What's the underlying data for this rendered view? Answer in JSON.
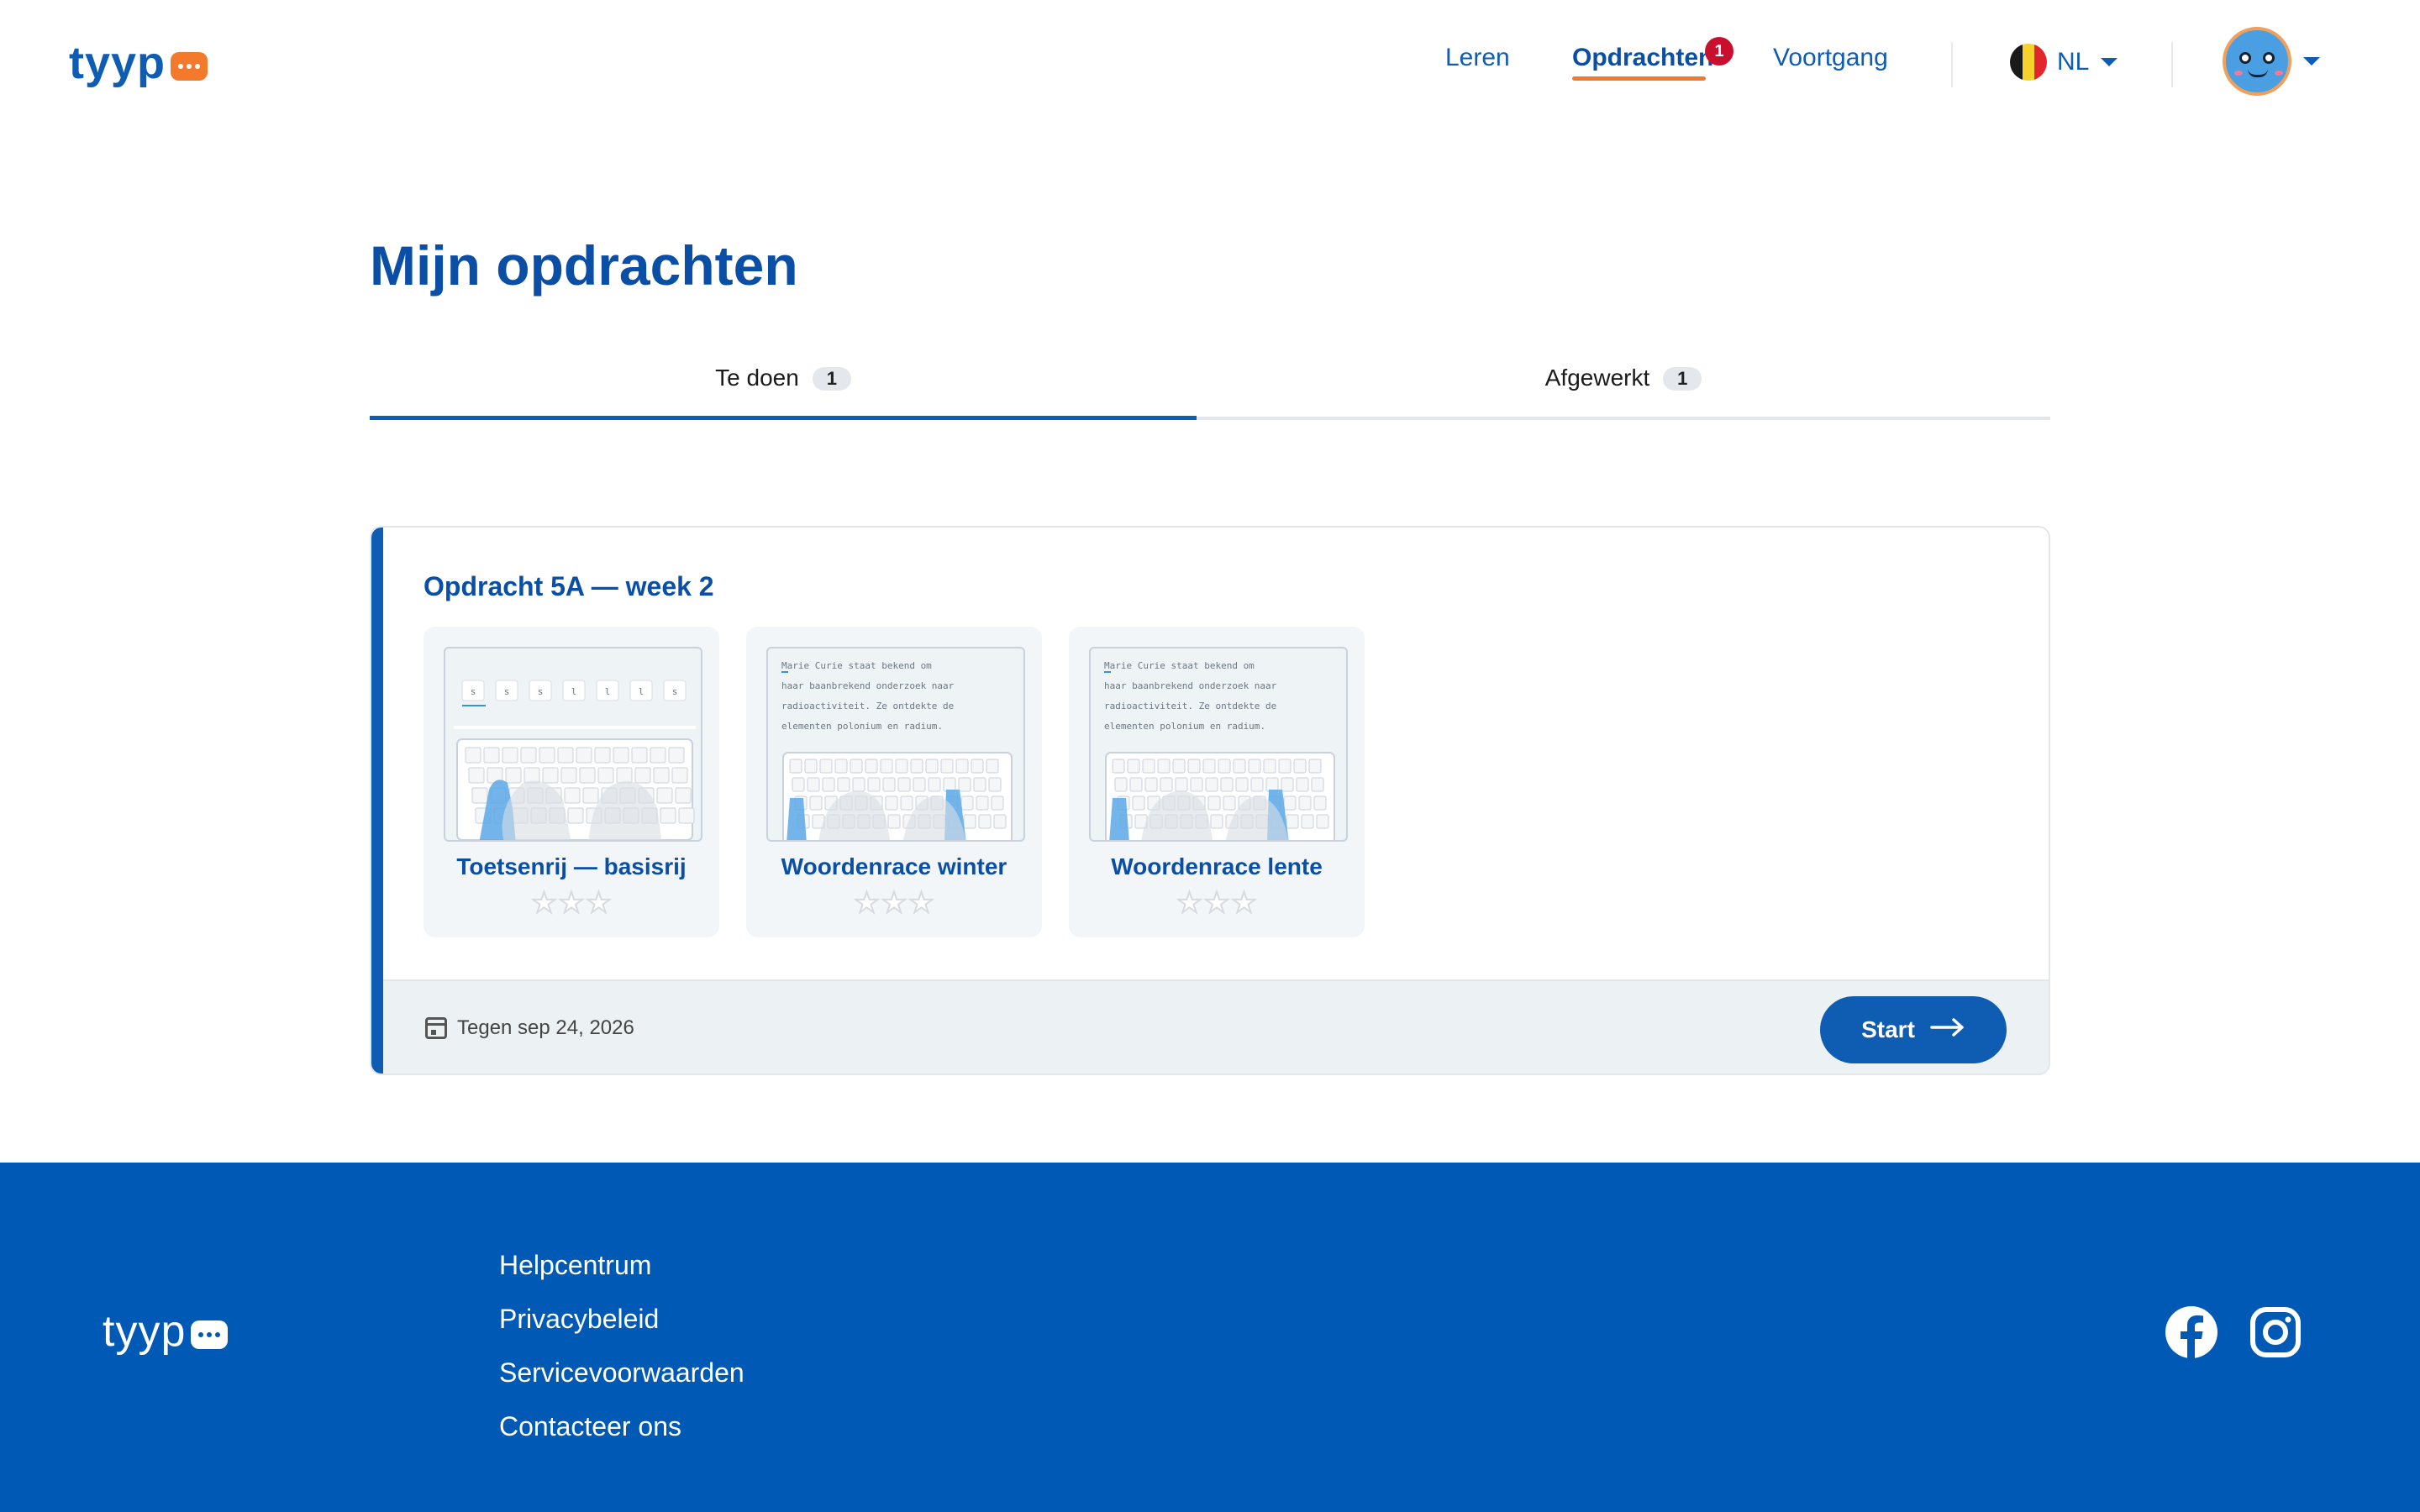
{
  "header": {
    "logo": "tyyp",
    "nav": [
      {
        "label": "Leren"
      },
      {
        "label": "Opdrachten",
        "badge": "1",
        "active": true
      },
      {
        "label": "Voortgang"
      }
    ],
    "language": "NL"
  },
  "page": {
    "title": "Mijn opdrachten"
  },
  "tabs": [
    {
      "label": "Te doen",
      "count": "1",
      "active": true
    },
    {
      "label": "Afgewerkt",
      "count": "1",
      "active": false
    }
  ],
  "assignment": {
    "title": "Opdracht 5A — week 2",
    "exercises": [
      {
        "name": "Toetsenrij — basisrij",
        "stars": 0,
        "max_stars": 3,
        "thumb_keys": [
          "s",
          "s",
          "s",
          "l",
          "l",
          "l",
          "s"
        ]
      },
      {
        "name": "Woordenrace winter",
        "stars": 0,
        "max_stars": 3,
        "thumb_text": [
          "Marie Curie staat bekend om",
          "haar baanbrekend onderzoek naar",
          "radioactiviteit. Ze ontdekte de",
          "elementen polonium en radium."
        ]
      },
      {
        "name": "Woordenrace lente",
        "stars": 0,
        "max_stars": 3,
        "thumb_text": [
          "Marie Curie staat bekend om",
          "haar baanbrekend onderzoek naar",
          "radioactiviteit. Ze ontdekte de",
          "elementen polonium en radium."
        ]
      }
    ],
    "due": "Tegen sep 24, 2026",
    "start_label": "Start"
  },
  "footer": {
    "logo": "tyyp",
    "links": [
      "Helpcentrum",
      "Privacybeleid",
      "Servicevoorwaarden",
      "Contacteer ons"
    ]
  },
  "colors": {
    "primary": "#0f5cb3",
    "accent": "#f47a2b",
    "badge": "#c8102e",
    "footer_bg": "#005ab5"
  }
}
